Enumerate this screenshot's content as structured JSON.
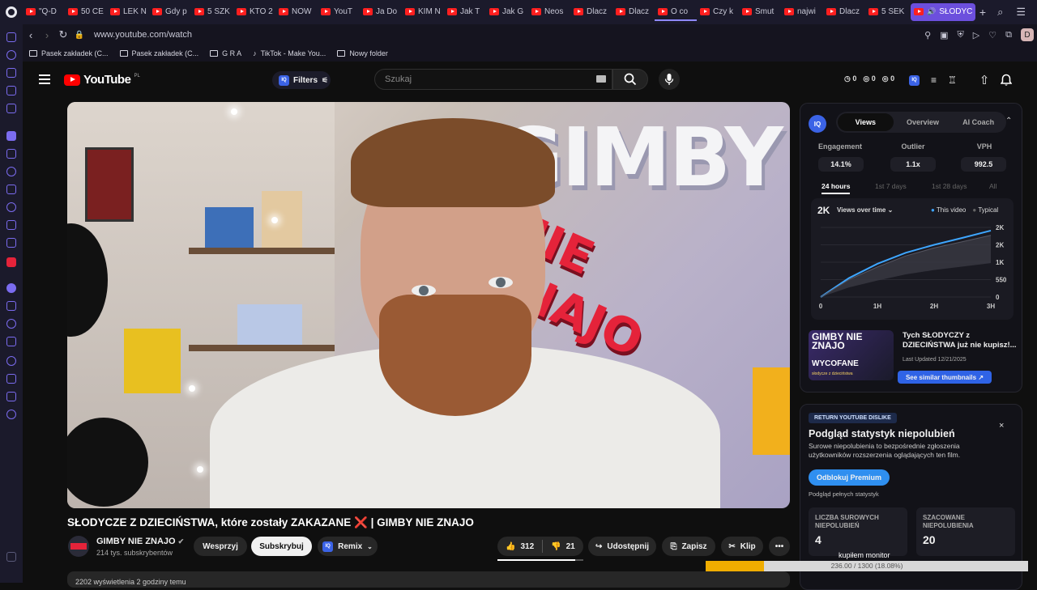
{
  "browser": {
    "tabs": [
      "\"Q-D",
      "50 CE",
      "LEK N",
      "Gdy p",
      "5 SZK",
      "KTO 2",
      "NOW",
      "YouT",
      "Ja Do",
      "KIM N",
      "Jak T",
      "Jak G",
      "Neos",
      "Dlacz",
      "Dlacz",
      "O co",
      "Czy k",
      "Smut",
      "najwi",
      "Dlacz",
      "5 SEK"
    ],
    "active_tab": "SŁODYC",
    "url": "www.youtube.com/watch",
    "profile_letter": "D",
    "bookmarks": [
      "Pasek zakładek (C...",
      "Pasek zakładek (C...",
      "G R A",
      "TikTok - Make You...",
      "Nowy folder"
    ]
  },
  "youtube": {
    "logo_text": "YouTube",
    "country": "PL",
    "filters_label": "Filters",
    "search_placeholder": "Szukaj",
    "stats": [
      "0",
      "0",
      "0"
    ]
  },
  "video": {
    "thumb_text_1": "GIMBY",
    "thumb_text_2": "NIE ZNAJO",
    "title": "SŁODYCZE Z DZIECIŃSTWA, które zostały ZAKAZANE",
    "title_mark": "❌",
    "title_suffix": "| GIMBY NIE ZNAJO",
    "channel": "GIMBY NIE ZNAJO",
    "subscribers": "214 tys. subskrybentów",
    "support": "Wesprzyj",
    "subscribe": "Subskrybuj",
    "remix": "Remix",
    "likes": "312",
    "dislikes": "21",
    "share": "Udostępnij",
    "save": "Zapisz",
    "clip": "Klip",
    "comments_preview": "2202 wyświetlenia 2 godziny temu"
  },
  "vidiq": {
    "tabs": [
      "Views",
      "Overview",
      "AI Coach"
    ],
    "metrics": [
      {
        "label": "Engagement",
        "value": "14.1%"
      },
      {
        "label": "Outlier",
        "value": "1.1x"
      },
      {
        "label": "VPH",
        "value": "992.5"
      }
    ],
    "ranges": [
      "24 hours",
      "1st 7 days",
      "1st 28 days",
      "All"
    ],
    "chart_headline": "2K",
    "chart_dropdown": "Views over time",
    "legend_this": "This video",
    "legend_typical": "Typical",
    "similar_title": "Tych SŁODYCZY z DZIECIŃSTWA już nie kupisz!...",
    "last_updated": "Last Updated 12/21/2025",
    "see_similar": "See similar thumbnails",
    "thumb_top": "GIMBY NIE ZNAJO",
    "thumb_bottom": "WYCOFANE",
    "thumb_caption": "słodycze z dzieciństwa"
  },
  "chart_data": {
    "type": "line",
    "x_ticks": [
      "0",
      "1H",
      "2H",
      "3H"
    ],
    "y_ticks": [
      "0",
      "550",
      "1K",
      "2K",
      "2K"
    ],
    "series": [
      {
        "name": "This video",
        "color": "#3ea6ff",
        "x": [
          0,
          0.5,
          1,
          1.5,
          2,
          2.5,
          3
        ],
        "y": [
          0,
          600,
          1050,
          1400,
          1650,
          1870,
          2100
        ]
      },
      {
        "name": "Typical",
        "color": "#555560",
        "x": [
          0,
          0.5,
          1,
          1.5,
          2,
          2.5,
          3
        ],
        "y": [
          0,
          550,
          950,
          1300,
          1550,
          1750,
          1950
        ]
      }
    ],
    "ylim": [
      0,
      2200
    ],
    "xlim": [
      0,
      3
    ],
    "grid": true,
    "legend_placement": "top-right"
  },
  "rtd": {
    "badge": "RETURN YOUTUBE DISLIKE",
    "heading": "Podgląd statystyk niepolubień",
    "description": "Surowe niepolubienia to bezpośrednie zgłoszenia użytkowników rozszerzenia oglądających ten film.",
    "premium_button": "Odblokuj Premium",
    "full_stats": "Podgląd pełnych statystyk",
    "raw_label": "LICZBA SUROWYCH NIEPOLUBIEŃ",
    "raw_value": "4",
    "est_label": "SZACOWANE NIEPOLUBIENIA",
    "est_value": "20",
    "close": "×"
  },
  "overlay": {
    "title": "kupiłem monitor",
    "progress_text": "236.00 / 1300 (18.08%)",
    "progress_fraction": 0.1808
  }
}
